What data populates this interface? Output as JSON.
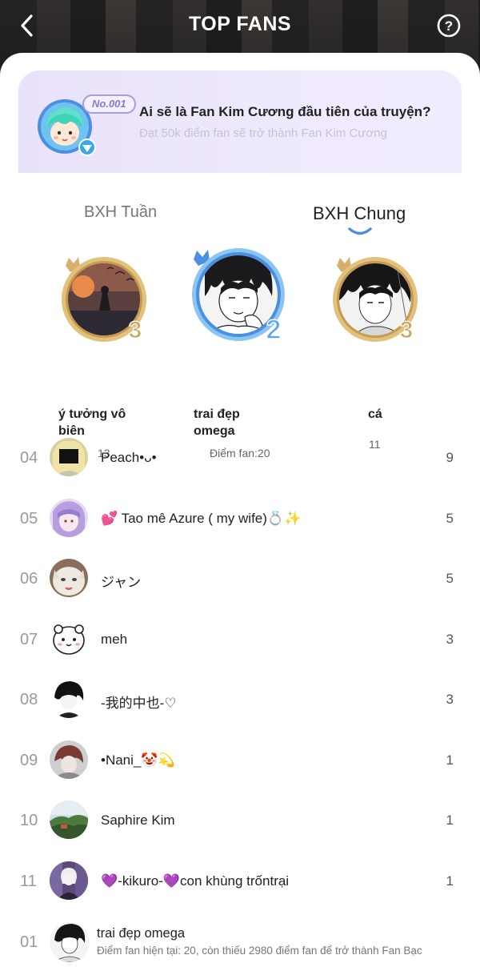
{
  "header": {
    "title": "TOP FANS"
  },
  "banner": {
    "badge": "No.001",
    "title": "Ai sẽ là Fan Kim Cương đầu tiên của truyện?",
    "subtitle": "Đạt 50k điểm fan sẽ trở thành Fan Kim Cương"
  },
  "tabs": [
    {
      "label": "BXH Tuần",
      "active": false
    },
    {
      "label": "BXH Chung",
      "active": true
    }
  ],
  "podium": [
    {
      "name_line1": "ý tưởng vô",
      "name_line2": "biên",
      "rank": "3",
      "score": "13"
    },
    {
      "name_line1": "trai đẹp",
      "name_line2": "omega",
      "rank": "2",
      "score": "Điểm fan:20"
    },
    {
      "name_line1": "cá",
      "name_line2": "",
      "rank": "3",
      "score": "11"
    }
  ],
  "list": [
    {
      "rank": "04",
      "name": "Peach•ᴗ•",
      "score": "9"
    },
    {
      "rank": "05",
      "name": "💕 Tao mê Azure ( my wife)💍✨",
      "score": "5"
    },
    {
      "rank": "06",
      "name": "ジャン",
      "score": "5"
    },
    {
      "rank": "07",
      "name": "meh",
      "score": "3"
    },
    {
      "rank": "08",
      "name": "-我的中也-♡",
      "score": "3"
    },
    {
      "rank": "09",
      "name": "•Nani_🤡💫",
      "score": "1"
    },
    {
      "rank": "10",
      "name": "Saphire Kim",
      "score": "1"
    },
    {
      "rank": "11",
      "name": "💜-kikuro-💜con khùng trốntrại",
      "score": "1"
    }
  ],
  "me": {
    "rank": "01",
    "name": "trai đẹp omega",
    "detail": "Điểm fan hiện tại: 20, còn thiếu 2980 điểm fan để trở thành Fan Bạc"
  },
  "colors": {
    "accent_blue": "#4a90e2",
    "gold": "#c9a45c",
    "banner_bg": "#ece6fc"
  },
  "icons": [
    "back-arrow-icon",
    "help-icon",
    "diamond-icon",
    "crown-icon"
  ]
}
